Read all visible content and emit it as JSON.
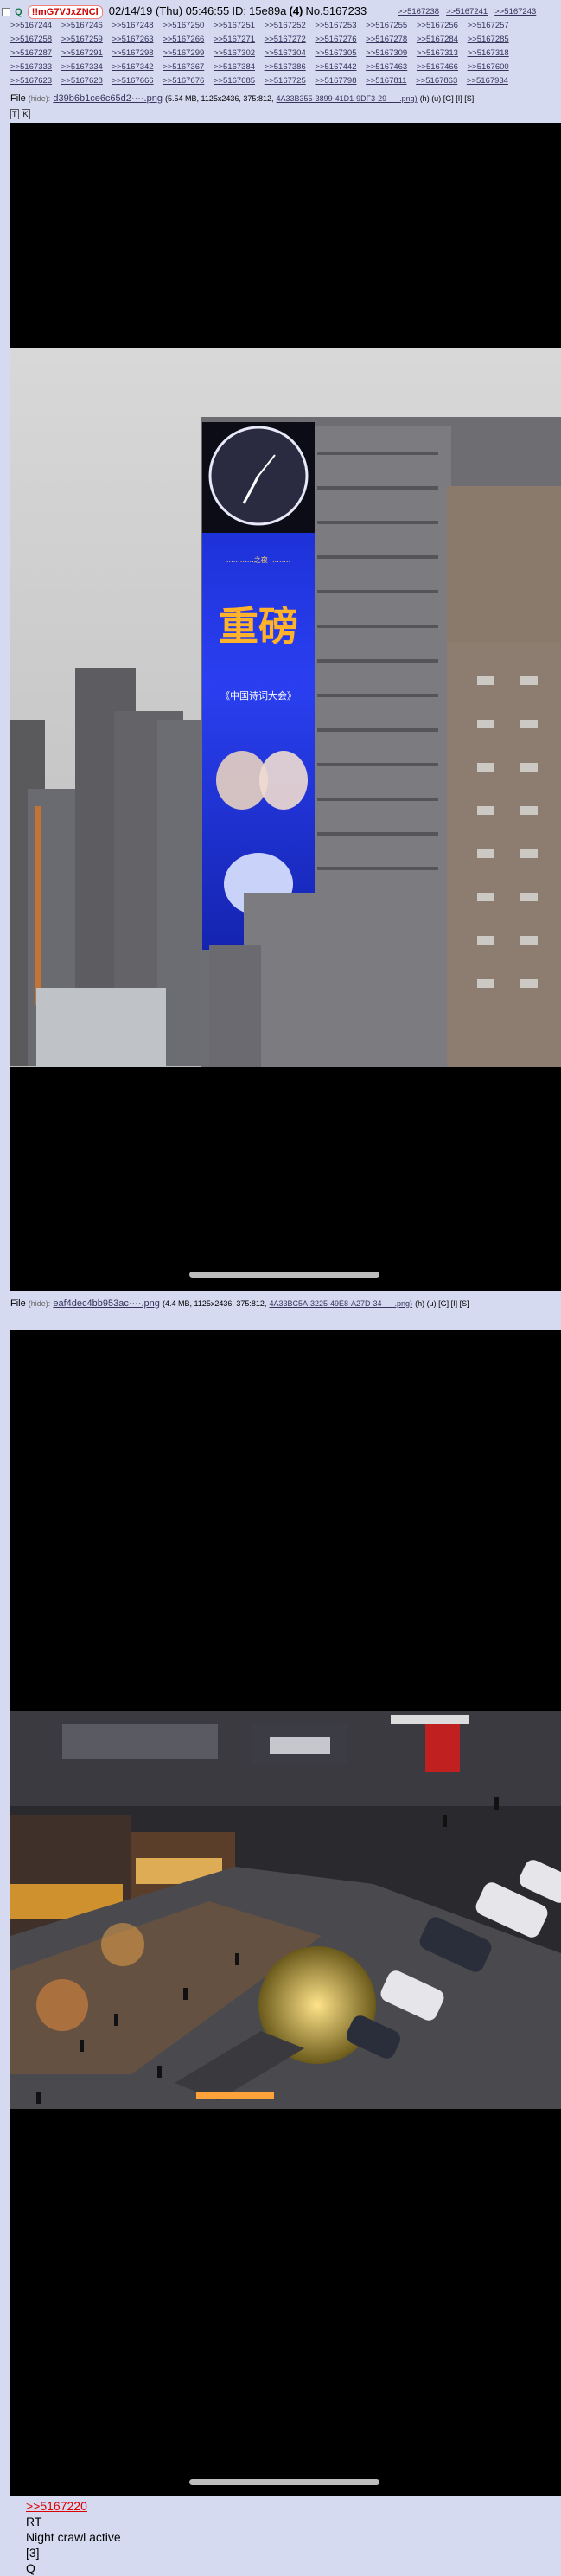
{
  "post": {
    "trip": "!!mG7VJxZNCl",
    "datetime": "02/14/19 (Thu) 05:46:55",
    "id_label": "ID:",
    "id_value": "15e89a",
    "id_count": "(4)",
    "number": "No.5167233"
  },
  "backlinks": [
    ">>5167238",
    ">>5167241",
    ">>5167243",
    ">>5167244",
    ">>5167246",
    ">>5167248",
    ">>5167250",
    ">>5167251",
    ">>5167252",
    ">>5167253",
    ">>5167255",
    ">>5167256",
    ">>5167257",
    ">>5167258",
    ">>5167259",
    ">>5167263",
    ">>5167266",
    ">>5167271",
    ">>5167272",
    ">>5167276",
    ">>5167278",
    ">>5167284",
    ">>5167285",
    ">>5167287",
    ">>5167291",
    ">>5167298",
    ">>5167299",
    ">>5167302",
    ">>5167304",
    ">>5167305",
    ">>5167309",
    ">>5167313",
    ">>5167318",
    ">>5167333",
    ">>5167334",
    ">>5167342",
    ">>5167367",
    ">>5167384",
    ">>5167386",
    ">>5167442",
    ">>5167463",
    ">>5167466",
    ">>5167600",
    ">>5167623",
    ">>5167628",
    ">>5167666",
    ">>5167676",
    ">>5167685",
    ">>5167725",
    ">>5167798",
    ">>5167811",
    ">>5167863",
    ">>5167934"
  ],
  "files": [
    {
      "label": "File",
      "hide": "(hide):",
      "name": "d39b6b1ce6c65d2····.png",
      "meta": "(5.54 MB, 1125x2436, 375:812,",
      "orig": "4A33B355-3899-41D1-9DF3-29·····.png)",
      "tools": "(h) (u) [G] [I] [S]",
      "extra_buttons": [
        "T",
        "K"
      ]
    },
    {
      "label": "File",
      "hide": "(hide):",
      "name": "eaf4dec4bb953ac····.png",
      "meta": "(4.4 MB, 1125x2436, 375:812,",
      "orig": "4A33BC5A-3225-49E8-A27D-34·····.png)",
      "tools": "(h) (u) [G] [I] [S]"
    }
  ],
  "comment": {
    "quote": ">>5167220",
    "lines": [
      "RT",
      "Night crawl active",
      "[3]",
      "Q"
    ]
  },
  "billboard": {
    "top_text": "…………之夜 ………",
    "calligraphy": "重磅",
    "subtitle": "《中国诗词大会》"
  },
  "colors": {
    "page_bg": "#d6daf0",
    "link": "#34345c",
    "quote": "#dd0000",
    "trip": "#cc0000",
    "billboard_blue": "#1e35d8",
    "lights": "#ffb030"
  }
}
